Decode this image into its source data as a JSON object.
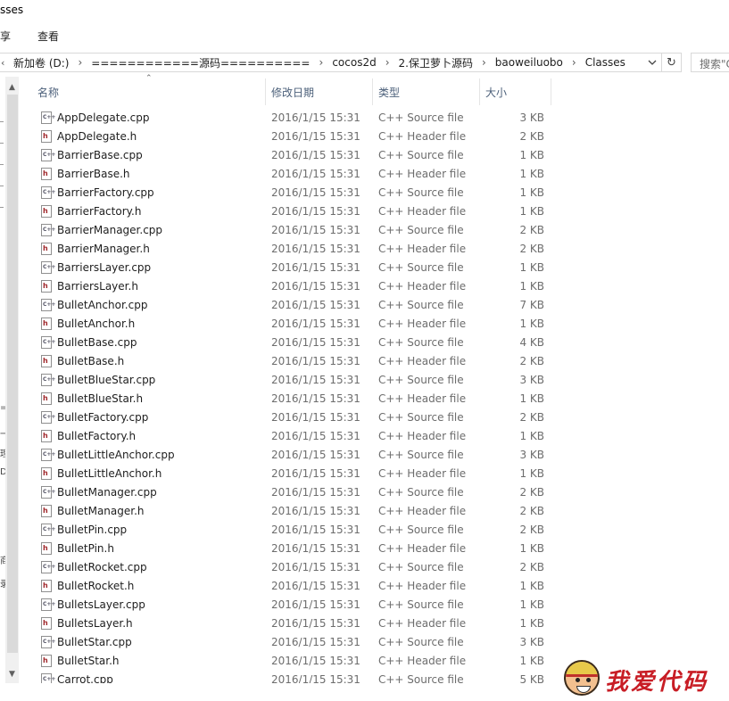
{
  "window": {
    "title_fragment": "sses"
  },
  "ribbon": {
    "tabs": [
      "享",
      "查看"
    ]
  },
  "address": {
    "crumbs": [
      "新加卷 (D:)",
      "============源码==========",
      "cocos2d",
      "2.保卫萝卜源码",
      "baoweiluobo",
      "Classes"
    ],
    "search_placeholder": "搜索\"C"
  },
  "nav_fragments": [
    "=",
    "一",
    "理",
    "D",
    "商",
    "录"
  ],
  "columns": {
    "name": "名称",
    "date": "修改日期",
    "type": "类型",
    "size": "大小"
  },
  "files": [
    {
      "name": "AppDelegate.cpp",
      "date": "2016/1/15 15:31",
      "type": "C++ Source file",
      "size": "3 KB"
    },
    {
      "name": "AppDelegate.h",
      "date": "2016/1/15 15:31",
      "type": "C++ Header file",
      "size": "2 KB"
    },
    {
      "name": "BarrierBase.cpp",
      "date": "2016/1/15 15:31",
      "type": "C++ Source file",
      "size": "1 KB"
    },
    {
      "name": "BarrierBase.h",
      "date": "2016/1/15 15:31",
      "type": "C++ Header file",
      "size": "1 KB"
    },
    {
      "name": "BarrierFactory.cpp",
      "date": "2016/1/15 15:31",
      "type": "C++ Source file",
      "size": "1 KB"
    },
    {
      "name": "BarrierFactory.h",
      "date": "2016/1/15 15:31",
      "type": "C++ Header file",
      "size": "1 KB"
    },
    {
      "name": "BarrierManager.cpp",
      "date": "2016/1/15 15:31",
      "type": "C++ Source file",
      "size": "2 KB"
    },
    {
      "name": "BarrierManager.h",
      "date": "2016/1/15 15:31",
      "type": "C++ Header file",
      "size": "2 KB"
    },
    {
      "name": "BarriersLayer.cpp",
      "date": "2016/1/15 15:31",
      "type": "C++ Source file",
      "size": "1 KB"
    },
    {
      "name": "BarriersLayer.h",
      "date": "2016/1/15 15:31",
      "type": "C++ Header file",
      "size": "1 KB"
    },
    {
      "name": "BulletAnchor.cpp",
      "date": "2016/1/15 15:31",
      "type": "C++ Source file",
      "size": "7 KB"
    },
    {
      "name": "BulletAnchor.h",
      "date": "2016/1/15 15:31",
      "type": "C++ Header file",
      "size": "1 KB"
    },
    {
      "name": "BulletBase.cpp",
      "date": "2016/1/15 15:31",
      "type": "C++ Source file",
      "size": "4 KB"
    },
    {
      "name": "BulletBase.h",
      "date": "2016/1/15 15:31",
      "type": "C++ Header file",
      "size": "2 KB"
    },
    {
      "name": "BulletBlueStar.cpp",
      "date": "2016/1/15 15:31",
      "type": "C++ Source file",
      "size": "3 KB"
    },
    {
      "name": "BulletBlueStar.h",
      "date": "2016/1/15 15:31",
      "type": "C++ Header file",
      "size": "1 KB"
    },
    {
      "name": "BulletFactory.cpp",
      "date": "2016/1/15 15:31",
      "type": "C++ Source file",
      "size": "2 KB"
    },
    {
      "name": "BulletFactory.h",
      "date": "2016/1/15 15:31",
      "type": "C++ Header file",
      "size": "1 KB"
    },
    {
      "name": "BulletLittleAnchor.cpp",
      "date": "2016/1/15 15:31",
      "type": "C++ Source file",
      "size": "3 KB"
    },
    {
      "name": "BulletLittleAnchor.h",
      "date": "2016/1/15 15:31",
      "type": "C++ Header file",
      "size": "1 KB"
    },
    {
      "name": "BulletManager.cpp",
      "date": "2016/1/15 15:31",
      "type": "C++ Source file",
      "size": "2 KB"
    },
    {
      "name": "BulletManager.h",
      "date": "2016/1/15 15:31",
      "type": "C++ Header file",
      "size": "2 KB"
    },
    {
      "name": "BulletPin.cpp",
      "date": "2016/1/15 15:31",
      "type": "C++ Source file",
      "size": "2 KB"
    },
    {
      "name": "BulletPin.h",
      "date": "2016/1/15 15:31",
      "type": "C++ Header file",
      "size": "1 KB"
    },
    {
      "name": "BulletRocket.cpp",
      "date": "2016/1/15 15:31",
      "type": "C++ Source file",
      "size": "2 KB"
    },
    {
      "name": "BulletRocket.h",
      "date": "2016/1/15 15:31",
      "type": "C++ Header file",
      "size": "1 KB"
    },
    {
      "name": "BulletsLayer.cpp",
      "date": "2016/1/15 15:31",
      "type": "C++ Source file",
      "size": "1 KB"
    },
    {
      "name": "BulletsLayer.h",
      "date": "2016/1/15 15:31",
      "type": "C++ Header file",
      "size": "1 KB"
    },
    {
      "name": "BulletStar.cpp",
      "date": "2016/1/15 15:31",
      "type": "C++ Source file",
      "size": "3 KB"
    },
    {
      "name": "BulletStar.h",
      "date": "2016/1/15 15:31",
      "type": "C++ Header file",
      "size": "1 KB"
    },
    {
      "name": "Carrot.cpp",
      "date": "2016/1/15 15:31",
      "type": "C++ Source file",
      "size": "5 KB"
    }
  ],
  "icons": {
    "cpp": "cpp-file-icon",
    "h": "header-file-icon"
  },
  "watermark": {
    "text": "我爱代码",
    "color": "#c81d25"
  }
}
